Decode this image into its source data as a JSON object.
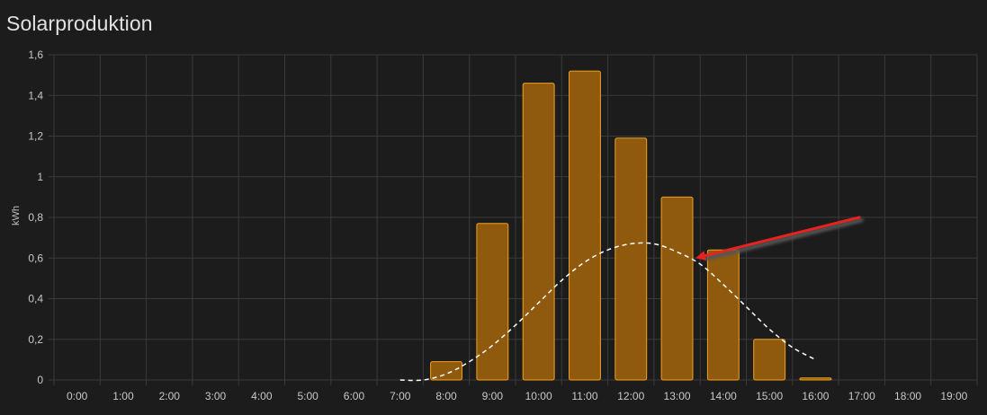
{
  "card": {
    "title": "Solarproduktion"
  },
  "colors": {
    "background": "#1c1c1c",
    "grid": "#3a3a3a",
    "bar_fill": "#8f5a0e",
    "bar_stroke": "#f0a020",
    "forecast_line": "#ffffff",
    "arrow": "#e8231f",
    "arrow_shadow": "#555555"
  },
  "chart_data": {
    "type": "bar",
    "title": "",
    "xlabel": "",
    "ylabel": "kWh",
    "ylim": [
      0,
      1.6
    ],
    "yticks": [
      "0",
      "0,2",
      "0,4",
      "0,6",
      "0,8",
      "1",
      "1,2",
      "1,4",
      "1,6"
    ],
    "grid": true,
    "categories": [
      "0:00",
      "1:00",
      "2:00",
      "3:00",
      "4:00",
      "5:00",
      "6:00",
      "7:00",
      "8:00",
      "9:00",
      "10:00",
      "11:00",
      "12:00",
      "13:00",
      "14:00",
      "15:00",
      "16:00",
      "17:00",
      "18:00",
      "19:00"
    ],
    "series": [
      {
        "kind": "bar",
        "values": [
          0,
          0,
          0,
          0,
          0,
          0,
          0,
          0,
          0.09,
          0.77,
          1.46,
          1.52,
          1.19,
          0.9,
          0.64,
          0.2,
          0.01,
          0,
          0,
          0
        ]
      },
      {
        "kind": "line",
        "style": "dashed",
        "x_hours": [
          7.0,
          7.5,
          8.0,
          8.5,
          9.0,
          9.5,
          10.0,
          10.5,
          11.0,
          11.5,
          12.0,
          12.5,
          13.0,
          13.5,
          14.0,
          14.5,
          15.0,
          15.5,
          16.0
        ],
        "values": [
          0.0,
          0.0,
          0.03,
          0.09,
          0.17,
          0.27,
          0.38,
          0.49,
          0.58,
          0.64,
          0.67,
          0.67,
          0.63,
          0.57,
          0.47,
          0.36,
          0.25,
          0.16,
          0.1
        ]
      }
    ],
    "annotation": {
      "type": "arrow",
      "from": {
        "x_hour": 16.95,
        "value": 0.8
      },
      "to": {
        "x_hour": 13.4,
        "value": 0.6
      }
    }
  }
}
